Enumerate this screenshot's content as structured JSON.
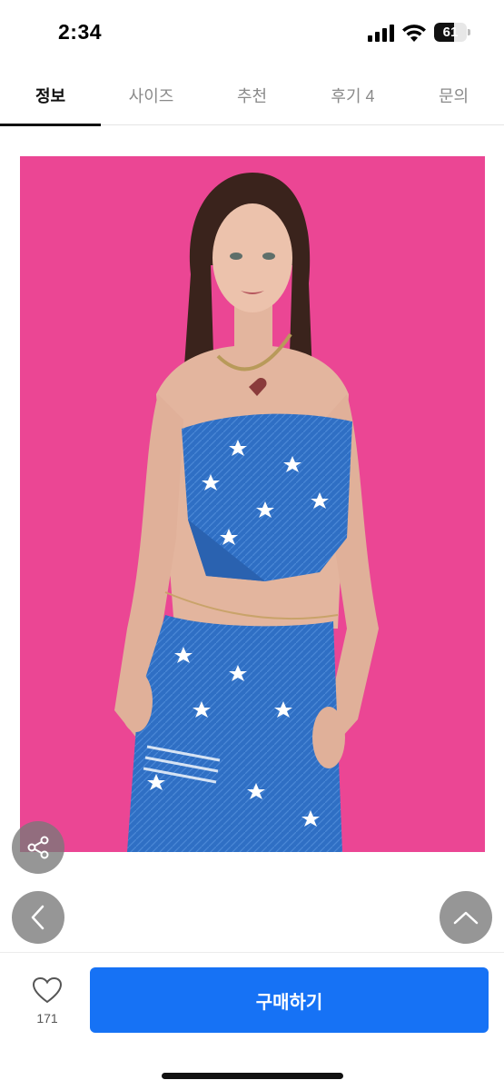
{
  "status_bar": {
    "time": "2:34",
    "battery_level": "61",
    "battery_fraction": 0.61
  },
  "tabs": [
    {
      "label": "정보",
      "active": true
    },
    {
      "label": "사이즈",
      "active": false
    },
    {
      "label": "추천",
      "active": false
    },
    {
      "label": "후기 4",
      "active": false
    },
    {
      "label": "문의",
      "active": false
    }
  ],
  "product_image": {
    "background_color": "#eb4694",
    "garment_color": "#2d6cc0"
  },
  "floating_buttons": {
    "share_icon": "share-icon",
    "prev_icon": "chevron-left-icon",
    "top_icon": "chevron-up-icon"
  },
  "bottom_bar": {
    "like_count": "171",
    "buy_label": "구매하기",
    "buy_color": "#1672f5"
  }
}
